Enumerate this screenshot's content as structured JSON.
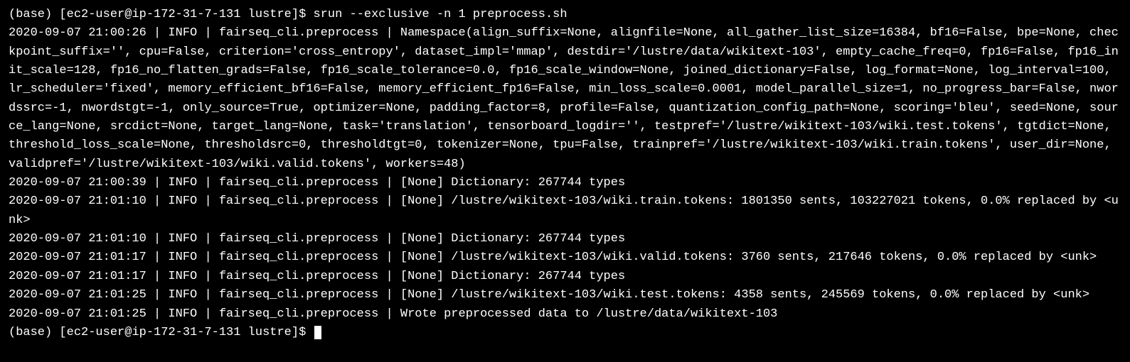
{
  "prompt1": {
    "env": "(base)",
    "user_host": "[ec2-user@ip-172-31-7-131 lustre]$",
    "command": "srun --exclusive -n 1 preprocess.sh"
  },
  "lines": [
    "2020-09-07 21:00:26 | INFO | fairseq_cli.preprocess | Namespace(align_suffix=None, alignfile=None, all_gather_list_size=16384, bf16=False, bpe=None, checkpoint_suffix='', cpu=False, criterion='cross_entropy', dataset_impl='mmap', destdir='/lustre/data/wikitext-103', empty_cache_freq=0, fp16=False, fp16_init_scale=128, fp16_no_flatten_grads=False, fp16_scale_tolerance=0.0, fp16_scale_window=None, joined_dictionary=False, log_format=None, log_interval=100, lr_scheduler='fixed', memory_efficient_bf16=False, memory_efficient_fp16=False, min_loss_scale=0.0001, model_parallel_size=1, no_progress_bar=False, nwordssrc=-1, nwordstgt=-1, only_source=True, optimizer=None, padding_factor=8, profile=False, quantization_config_path=None, scoring='bleu', seed=None, source_lang=None, srcdict=None, target_lang=None, task='translation', tensorboard_logdir='', testpref='/lustre/wikitext-103/wiki.test.tokens', tgtdict=None, threshold_loss_scale=None, thresholdsrc=0, thresholdtgt=0, tokenizer=None, tpu=False, trainpref='/lustre/wikitext-103/wiki.train.tokens', user_dir=None, validpref='/lustre/wikitext-103/wiki.valid.tokens', workers=48)",
    "2020-09-07 21:00:39 | INFO | fairseq_cli.preprocess | [None] Dictionary: 267744 types",
    "2020-09-07 21:01:10 | INFO | fairseq_cli.preprocess | [None] /lustre/wikitext-103/wiki.train.tokens: 1801350 sents, 103227021 tokens, 0.0% replaced by <unk>",
    "2020-09-07 21:01:10 | INFO | fairseq_cli.preprocess | [None] Dictionary: 267744 types",
    "2020-09-07 21:01:17 | INFO | fairseq_cli.preprocess | [None] /lustre/wikitext-103/wiki.valid.tokens: 3760 sents, 217646 tokens, 0.0% replaced by <unk>",
    "2020-09-07 21:01:17 | INFO | fairseq_cli.preprocess | [None] Dictionary: 267744 types",
    "2020-09-07 21:01:25 | INFO | fairseq_cli.preprocess | [None] /lustre/wikitext-103/wiki.test.tokens: 4358 sents, 245569 tokens, 0.0% replaced by <unk>",
    "2020-09-07 21:01:25 | INFO | fairseq_cli.preprocess | Wrote preprocessed data to /lustre/data/wikitext-103"
  ],
  "prompt2": {
    "env": "(base)",
    "user_host": "[ec2-user@ip-172-31-7-131 lustre]$"
  }
}
